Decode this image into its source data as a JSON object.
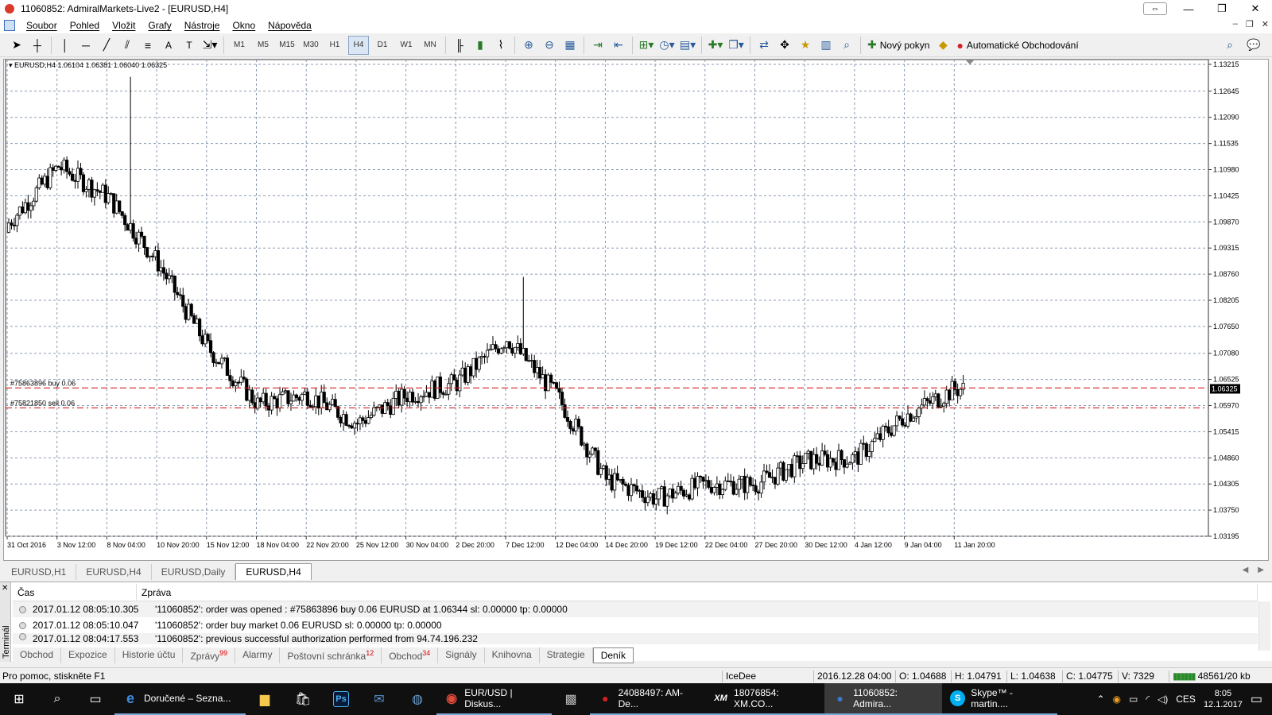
{
  "window": {
    "title": "11060852: AdmiralMarkets-Live2 - [EURUSD,H4]"
  },
  "menu": {
    "items": [
      "Soubor",
      "Pohled",
      "Vložit",
      "Grafy",
      "Nástroje",
      "Okno",
      "Nápověda"
    ]
  },
  "toolbar": {
    "timeframes": [
      "M1",
      "M5",
      "M15",
      "M30",
      "H1",
      "H4",
      "D1",
      "W1",
      "MN"
    ],
    "active_timeframe": "H4",
    "new_order_label": "Nový pokyn",
    "auto_trading_label": "Automatické Obchodování"
  },
  "chart": {
    "header": "EURUSD,H4  1.06104 1.06381 1.06040 1.06325",
    "price_axis": [
      "1.13215",
      "1.12645",
      "1.12090",
      "1.11535",
      "1.10980",
      "1.10425",
      "1.09870",
      "1.09315",
      "1.08760",
      "1.08205",
      "1.07650",
      "1.07080",
      "1.06525",
      "1.05970",
      "1.05415",
      "1.04860",
      "1.04305",
      "1.03750",
      "1.03195"
    ],
    "current_price": "1.06325",
    "time_axis": [
      "31 Oct 2016",
      "3 Nov 12:00",
      "8 Nov 04:00",
      "10 Nov 20:00",
      "15 Nov 12:00",
      "18 Nov 04:00",
      "22 Nov 20:00",
      "25 Nov 12:00",
      "30 Nov 04:00",
      "2 Dec 20:00",
      "7 Dec 12:00",
      "12 Dec 04:00",
      "14 Dec 20:00",
      "19 Dec 12:00",
      "22 Dec 04:00",
      "27 Dec 20:00",
      "30 Dec 12:00",
      "4 Jan 12:00",
      "9 Jan 04:00",
      "11 Jan 20:00"
    ],
    "orders": [
      {
        "label": "#75863896 buy 0.06",
        "price": 1.06344
      },
      {
        "label": "#75821850 sell 0.06",
        "price": 1.0592
      }
    ],
    "colors": {
      "grid": "#8a9ab0",
      "candle": "#000000",
      "order_line": "#d42020"
    }
  },
  "chart_data": {
    "type": "candlestick",
    "symbol": "EURUSD",
    "timeframe": "H4",
    "ylim": [
      1.03195,
      1.13215
    ],
    "anchor_closes": [
      {
        "t": "31 Oct 2016",
        "close": 1.0985
      },
      {
        "t": "3 Nov 12:00",
        "close": 1.1105
      },
      {
        "t": "8 Nov 04:00",
        "close": 1.104
      },
      {
        "t": "10 Nov 20:00",
        "close": 1.09
      },
      {
        "t": "15 Nov 12:00",
        "close": 1.072
      },
      {
        "t": "18 Nov 04:00",
        "close": 1.06
      },
      {
        "t": "22 Nov 20:00",
        "close": 1.062
      },
      {
        "t": "25 Nov 12:00",
        "close": 1.056
      },
      {
        "t": "30 Nov 04:00",
        "close": 1.062
      },
      {
        "t": "2 Dec 20:00",
        "close": 1.0645
      },
      {
        "t": "7 Dec 12:00",
        "close": 1.074
      },
      {
        "t": "12 Dec 04:00",
        "close": 1.062
      },
      {
        "t": "14 Dec 20:00",
        "close": 1.044
      },
      {
        "t": "19 Dec 12:00",
        "close": 1.04
      },
      {
        "t": "22 Dec 04:00",
        "close": 1.043
      },
      {
        "t": "27 Dec 20:00",
        "close": 1.043
      },
      {
        "t": "30 Dec 12:00",
        "close": 1.048
      },
      {
        "t": "4 Jan 12:00",
        "close": 1.0485
      },
      {
        "t": "9 Jan 04:00",
        "close": 1.0575
      },
      {
        "t": "11 Jan 20:00",
        "close": 1.0632
      }
    ]
  },
  "chart_tabs": [
    "EURUSD,H1",
    "EURUSD,H4",
    "EURUSD,Daily",
    "EURUSD,H4"
  ],
  "active_chart_tab": 3,
  "terminal": {
    "side_label": "Terminál",
    "columns": [
      "Čas",
      "Zpráva"
    ],
    "rows": [
      {
        "time": "2017.01.12 08:05:10.305",
        "message": "'11060852': order was opened : #75863896 buy 0.06 EURUSD at 1.06344 sl: 0.00000 tp: 0.00000"
      },
      {
        "time": "2017.01.12 08:05:10.047",
        "message": "'11060852': order buy market 0.06 EURUSD sl: 0.00000 tp: 0.00000"
      },
      {
        "time": "2017.01.12 08:04:17.553",
        "message": "'11060852': previous successful authorization performed from 94.74.196.232"
      }
    ],
    "tabs": [
      {
        "label": "Obchod"
      },
      {
        "label": "Expozice"
      },
      {
        "label": "Historie účtu"
      },
      {
        "label": "Zprávy",
        "badge": "99"
      },
      {
        "label": "Alarmy"
      },
      {
        "label": "Poštovní schránka",
        "badge": "12"
      },
      {
        "label": "Obchod",
        "badge": "34"
      },
      {
        "label": "Signály"
      },
      {
        "label": "Knihovna"
      },
      {
        "label": "Strategie"
      },
      {
        "label": "Deník"
      }
    ],
    "active_tab": 10
  },
  "status": {
    "help": "Pro pomoc, stiskněte F1",
    "profile": "IceDee",
    "datetime": "2016.12.28 04:00",
    "open": "O: 1.04688",
    "high": "H: 1.04791",
    "low": "L: 1.04638",
    "close": "C: 1.04775",
    "volume": "V: 7329",
    "traffic": "48561/20 kb"
  },
  "taskbar": {
    "apps": [
      {
        "label": "Doručené – Sezna...",
        "icon": "edge-icon"
      },
      {
        "label": "EUR/USD | Diskus...",
        "icon": "chrome-icon"
      },
      {
        "label": "24088497: AM-De...",
        "icon": "metatrader-icon"
      },
      {
        "label": "18076854: XM.CO...",
        "icon": "xm-icon"
      },
      {
        "label": "11060852: Admira...",
        "icon": "metatrader-icon"
      },
      {
        "label": "Skype™ - martin....",
        "icon": "skype-icon"
      }
    ],
    "language": "CES",
    "time": "8:05",
    "date": "12.1.2017"
  }
}
